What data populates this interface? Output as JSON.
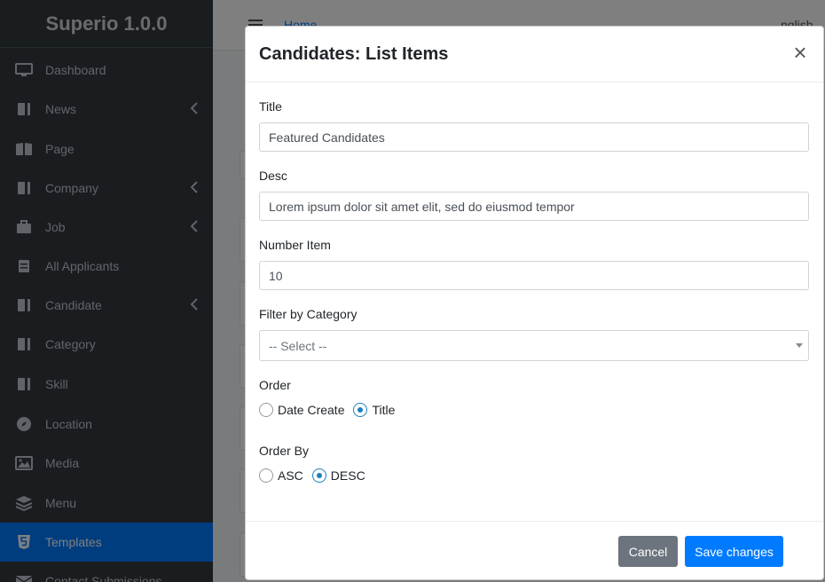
{
  "app": {
    "title": "Superio 1.0.0"
  },
  "sidebar": {
    "items": [
      {
        "label": "Dashboard",
        "icon": "monitor-icon",
        "has_chevron": false
      },
      {
        "label": "News",
        "icon": "book-icon",
        "has_chevron": true
      },
      {
        "label": "Page",
        "icon": "book-open-icon",
        "has_chevron": false
      },
      {
        "label": "Company",
        "icon": "book-icon",
        "has_chevron": true
      },
      {
        "label": "Job",
        "icon": "briefcase-icon",
        "has_chevron": true
      },
      {
        "label": "All Applicants",
        "icon": "file-icon",
        "has_chevron": false
      },
      {
        "label": "Candidate",
        "icon": "book-icon",
        "has_chevron": true
      },
      {
        "label": "Category",
        "icon": "book-icon",
        "has_chevron": false
      },
      {
        "label": "Skill",
        "icon": "book-icon",
        "has_chevron": false
      },
      {
        "label": "Location",
        "icon": "compass-icon",
        "has_chevron": false
      },
      {
        "label": "Media",
        "icon": "image-icon",
        "has_chevron": false
      },
      {
        "label": "Menu",
        "icon": "layers-icon",
        "has_chevron": false
      },
      {
        "label": "Templates",
        "icon": "html5-icon",
        "has_chevron": false,
        "active": true
      },
      {
        "label": "Contact Submissions",
        "icon": "envelope-icon",
        "has_chevron": false
      }
    ]
  },
  "topbar": {
    "home": "Home",
    "language": "nglish"
  },
  "modal": {
    "title": "Candidates: List Items",
    "fields": {
      "title": {
        "label": "Title",
        "value": "Featured Candidates"
      },
      "desc": {
        "label": "Desc",
        "value": "Lorem ipsum dolor sit amet elit, sed do eiusmod tempor"
      },
      "number_item": {
        "label": "Number Item",
        "value": "10"
      },
      "filter_category": {
        "label": "Filter by Category",
        "value": "-- Select --"
      },
      "order": {
        "label": "Order",
        "options": [
          "Date Create",
          "Title"
        ],
        "selected": "Title"
      },
      "order_by": {
        "label": "Order By",
        "options": [
          "ASC",
          "DESC"
        ],
        "selected": "DESC"
      }
    },
    "buttons": {
      "cancel": "Cancel",
      "save": "Save changes"
    }
  },
  "colors": {
    "sidebar_bg": "#343a40",
    "accent": "#007bff",
    "cancel": "#6c757d"
  }
}
